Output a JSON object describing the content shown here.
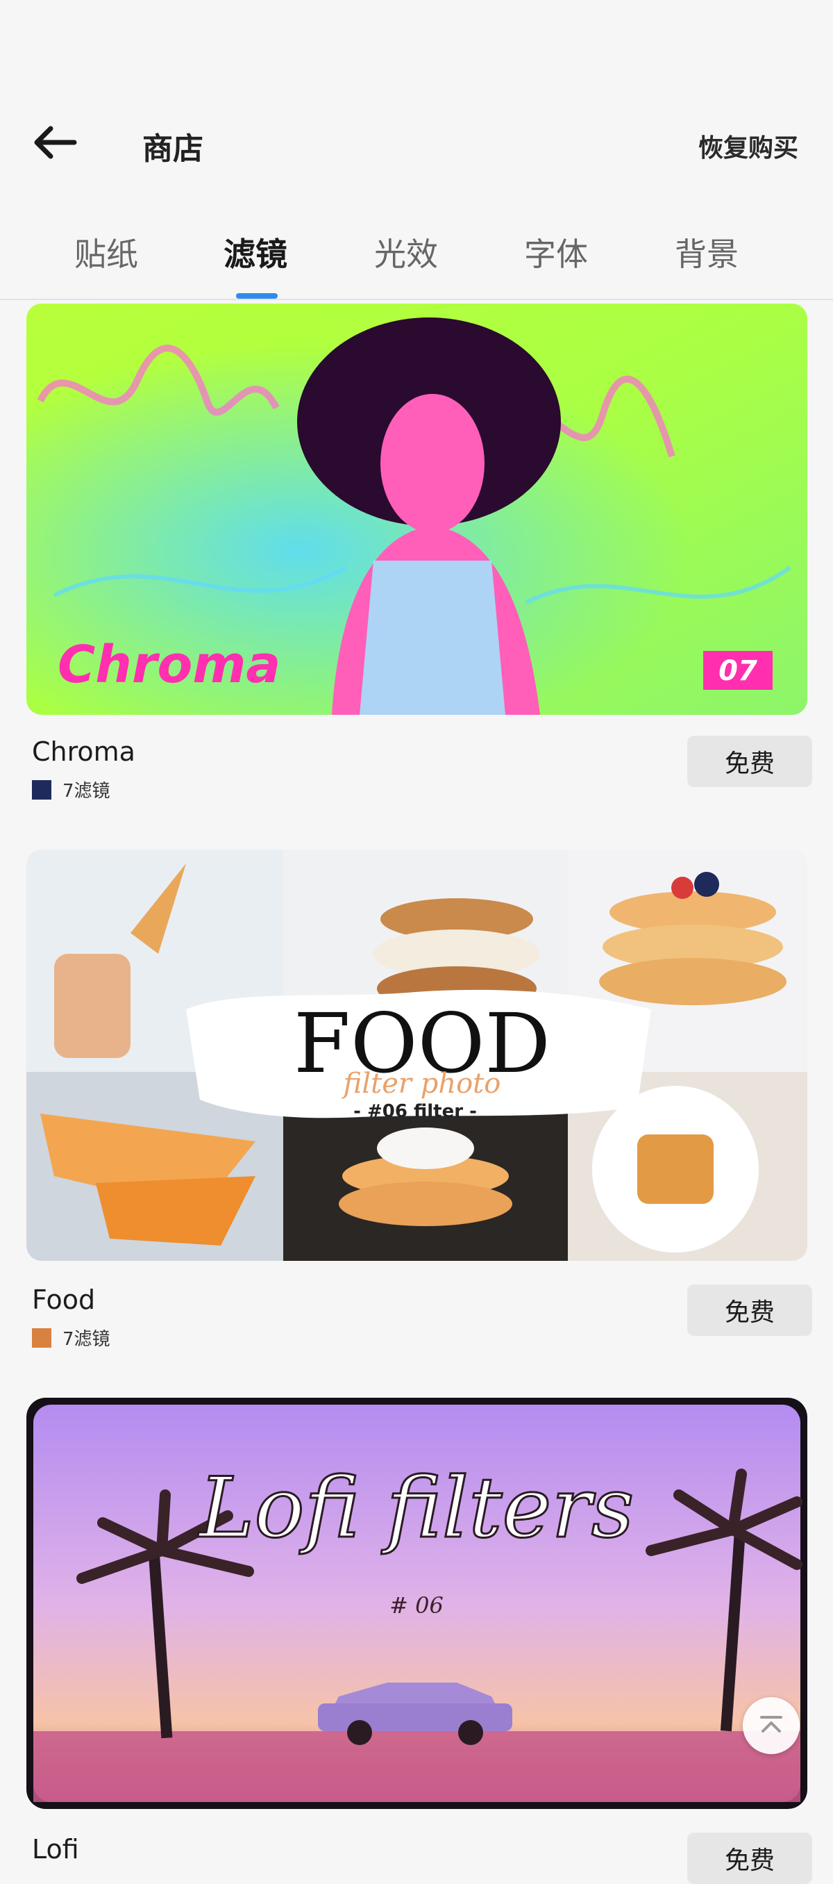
{
  "header": {
    "title": "商店",
    "restore_label": "恢复购买"
  },
  "tabs": [
    {
      "label": "贴纸",
      "active": false
    },
    {
      "label": "滤镜",
      "active": true
    },
    {
      "label": "光效",
      "active": false
    },
    {
      "label": "字体",
      "active": false
    },
    {
      "label": "背景",
      "active": false
    }
  ],
  "colors": {
    "accent": "#2f8bf0",
    "chroma_swatch": "#1f2a5c",
    "food_swatch": "#d9813f"
  },
  "cards": [
    {
      "name": "Chroma",
      "count": "7滤镜",
      "price_label": "免费",
      "banner_text": "Chroma",
      "banner_badge": "07"
    },
    {
      "name": "Food",
      "count": "7滤镜",
      "price_label": "免费",
      "banner_title": "FOOD",
      "banner_subtitle": "filter photo",
      "banner_tag": "- #06 filter -"
    },
    {
      "name": "Lofi",
      "count": "",
      "price_label": "免费",
      "banner_title": "Lofi filters",
      "banner_tag": "# 06"
    }
  ],
  "scroll_top_icon": "chevron-up-bar-icon"
}
